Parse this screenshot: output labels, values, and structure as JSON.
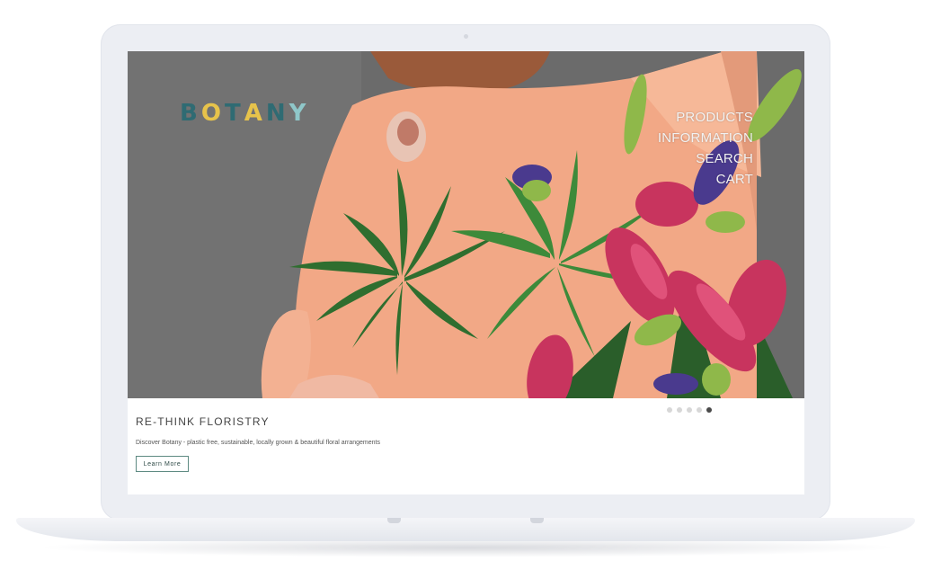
{
  "brand": {
    "logo_letters": [
      "B",
      "O",
      "T",
      "A",
      "N",
      "Y"
    ],
    "logo_colors": [
      "#2f6b73",
      "#e7c34b",
      "#2f6b73",
      "#e7c34b",
      "#2f6b73",
      "#8fc7c9"
    ]
  },
  "nav": {
    "items": [
      "PRODUCTS",
      "INFORMATION",
      "SEARCH",
      "CART"
    ]
  },
  "hero": {
    "title": "RE-THINK FLORISTRY",
    "description": "Discover Botany - plastic free, sustainable, locally grown & beautiful floral arrangements",
    "button_label": "Learn More"
  },
  "carousel": {
    "slide_count": 5,
    "active_index": 4
  },
  "colors": {
    "button_border": "#5e8a82",
    "dot_inactive": "#d7d7d7",
    "dot_active": "#4a4a4a"
  }
}
